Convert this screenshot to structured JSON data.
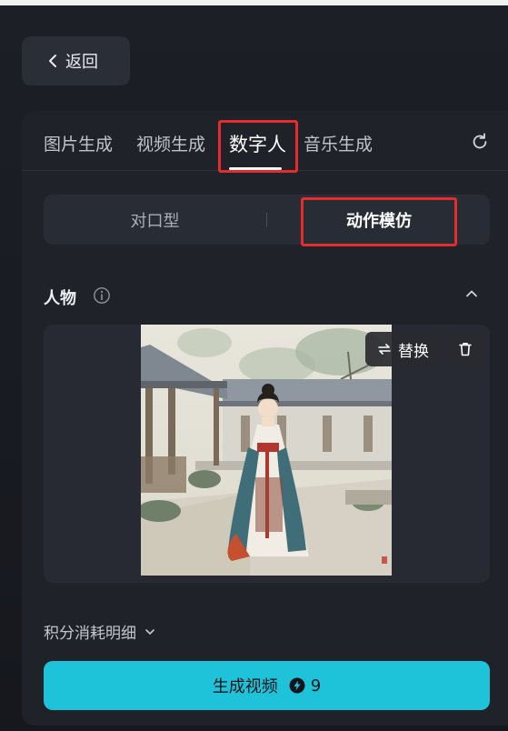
{
  "back": {
    "label": "返回"
  },
  "tabs": [
    {
      "label": "图片生成"
    },
    {
      "label": "视频生成"
    },
    {
      "label": "数字人",
      "active": true
    },
    {
      "label": "音乐生成"
    }
  ],
  "mode_switch": {
    "options": [
      "对口型",
      "动作模仿"
    ],
    "selected": "动作模仿"
  },
  "character_section": {
    "title": "人物"
  },
  "image_actions": {
    "replace_label": "替换"
  },
  "points_detail": {
    "label": "积分消耗明细"
  },
  "generate": {
    "label": "生成视频",
    "cost": "9"
  },
  "colors": {
    "accent": "#1fc3d9",
    "highlight": "#e52b2b",
    "panel": "#1f2229"
  }
}
